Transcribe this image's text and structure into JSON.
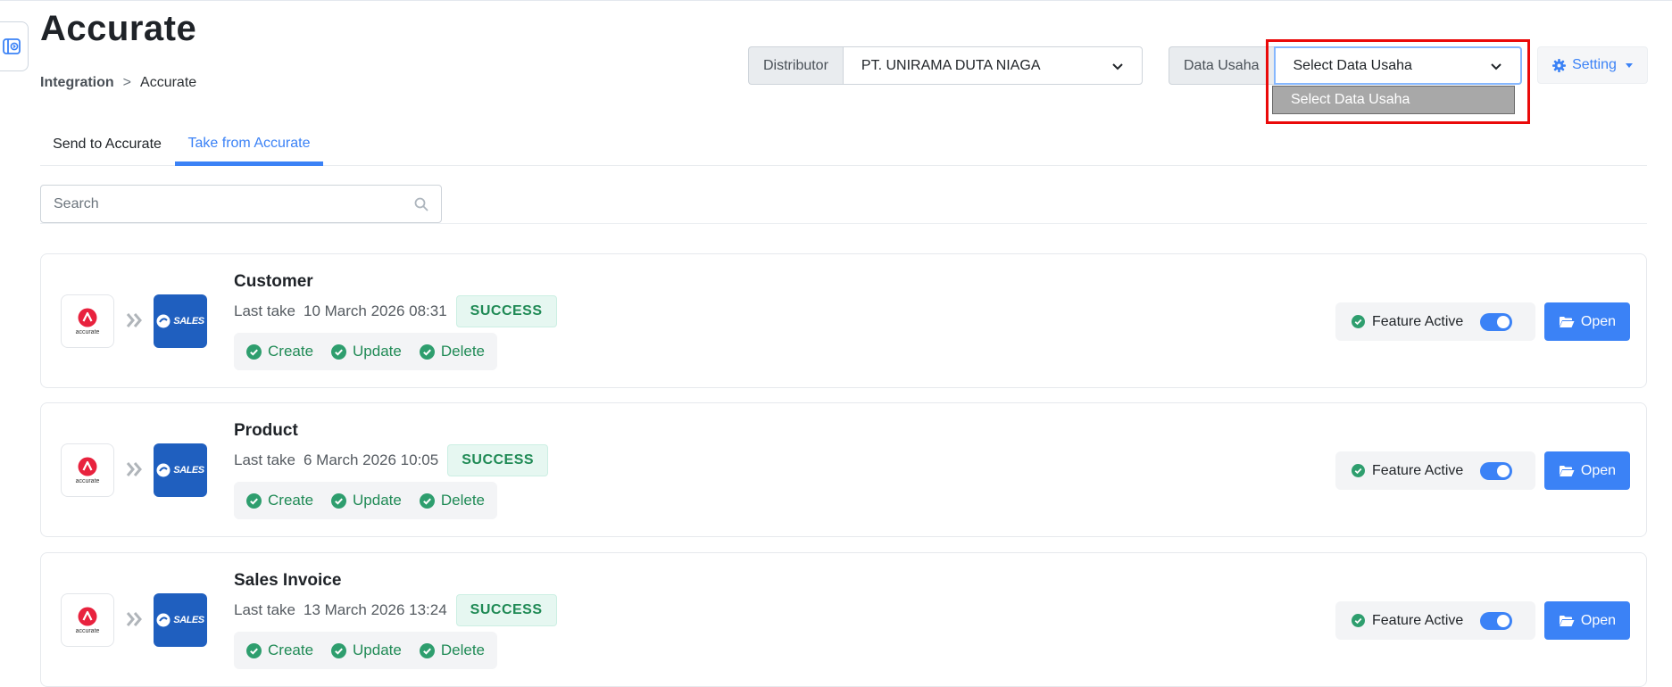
{
  "header": {
    "title": "Accurate",
    "breadcrumb": {
      "parent": "Integration",
      "separator": ">",
      "current": "Accurate"
    }
  },
  "filters": {
    "distributor": {
      "label": "Distributor",
      "value": "PT. UNIRAMA DUTA NIAGA"
    },
    "data_usaha": {
      "label": "Data Usaha",
      "value": "Select Data Usaha",
      "options": [
        "Select Data Usaha"
      ]
    },
    "setting_label": "Setting"
  },
  "tabs": [
    {
      "label": "Send to Accurate",
      "active": false
    },
    {
      "label": "Take from Accurate",
      "active": true
    }
  ],
  "search": {
    "placeholder": "Search"
  },
  "cards": [
    {
      "title": "Customer",
      "last_take_label": "Last take",
      "last_take": "10 March 2026 08:31",
      "status": "SUCCESS",
      "ops": [
        "Create",
        "Update",
        "Delete"
      ],
      "feature_label": "Feature Active",
      "feature_active": true,
      "open_label": "Open"
    },
    {
      "title": "Product",
      "last_take_label": "Last take",
      "last_take": "6 March 2026 10:05",
      "status": "SUCCESS",
      "ops": [
        "Create",
        "Update",
        "Delete"
      ],
      "feature_label": "Feature Active",
      "feature_active": true,
      "open_label": "Open"
    },
    {
      "title": "Sales Invoice",
      "last_take_label": "Last take",
      "last_take": "13 March 2026 13:24",
      "status": "SUCCESS",
      "ops": [
        "Create",
        "Update",
        "Delete"
      ],
      "feature_label": "Feature Active",
      "feature_active": true,
      "open_label": "Open"
    }
  ],
  "logos": {
    "accurate_word": "accurate",
    "sales_word": "SALES"
  },
  "colors": {
    "accent": "#3b82f6",
    "success": "#1f8a55",
    "highlight": "#ea0a0a",
    "sales_brand": "#1f5fbf",
    "accurate_brand": "#e8223e"
  },
  "icons": {
    "sidebar_toggle": "sidebar-toggle-icon",
    "search": "search-icon",
    "setting": "gear-icon",
    "check": "check-circle-icon",
    "open": "folder-open-icon",
    "arrows": "double-chevron-right-icon"
  }
}
